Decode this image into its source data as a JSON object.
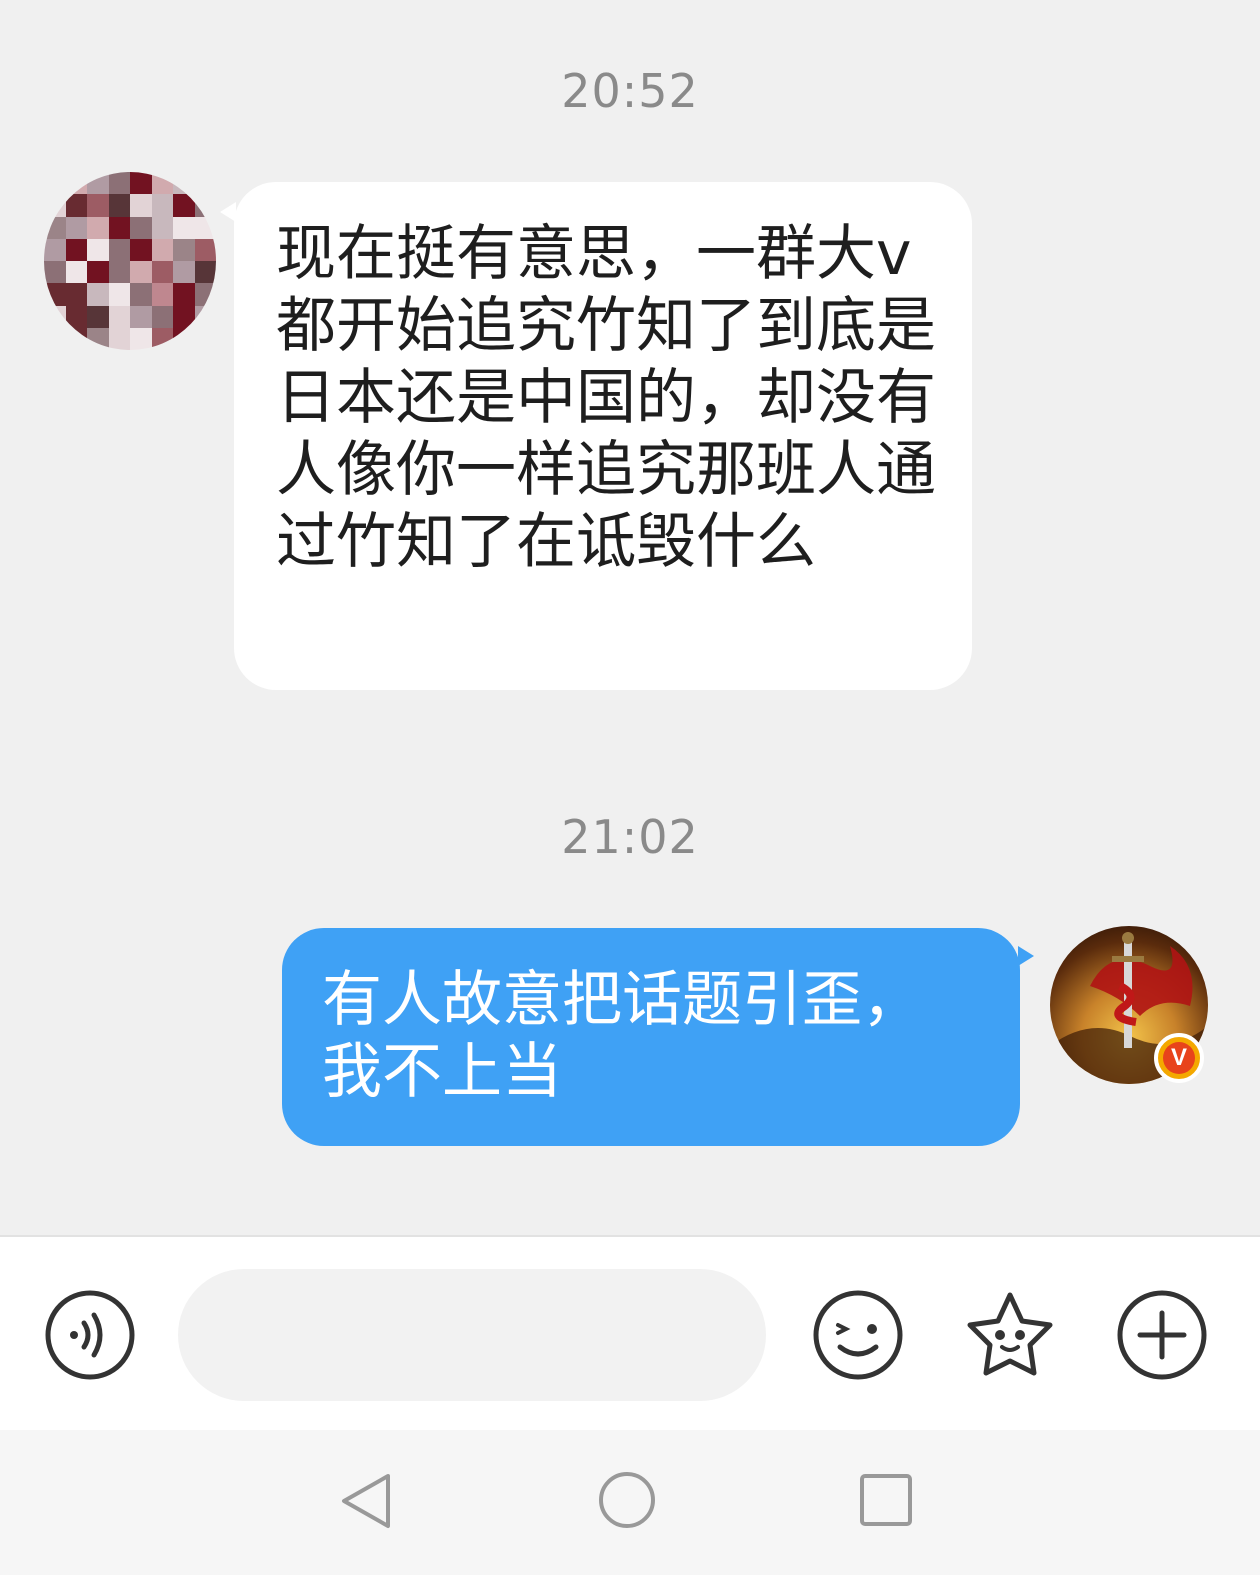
{
  "conversation": {
    "messages": [
      {
        "time": "20:52",
        "direction": "incoming",
        "text": "现在挺有意思，一群大v都开始追究竹知了到底是日本还是中国的，却没有人像你一样追究那班人通过竹知了在诋毁什么"
      },
      {
        "time": "21:02",
        "direction": "outgoing",
        "text": "有人故意把话题引歪，我不上当"
      }
    ],
    "sender_avatar": {
      "icon": "pixelated-avatar"
    },
    "self_avatar": {
      "icon": "sword-avatar",
      "badge": "V",
      "badge_color": "#f4a800"
    }
  },
  "input_bar": {
    "voice_icon": "voice-icon",
    "message_value": "",
    "emoji_icon": "smiley-icon",
    "sticker_icon": "star-sticker-icon",
    "more_icon": "plus-icon"
  },
  "system_nav": {
    "back_icon": "triangle-back-icon",
    "home_icon": "circle-home-icon",
    "recents_icon": "square-recents-icon"
  },
  "colors": {
    "background": "#f0f0f0",
    "incoming_bubble": "#ffffff",
    "outgoing_bubble": "#3fa1f5",
    "timestamp": "#8a8a8a"
  }
}
